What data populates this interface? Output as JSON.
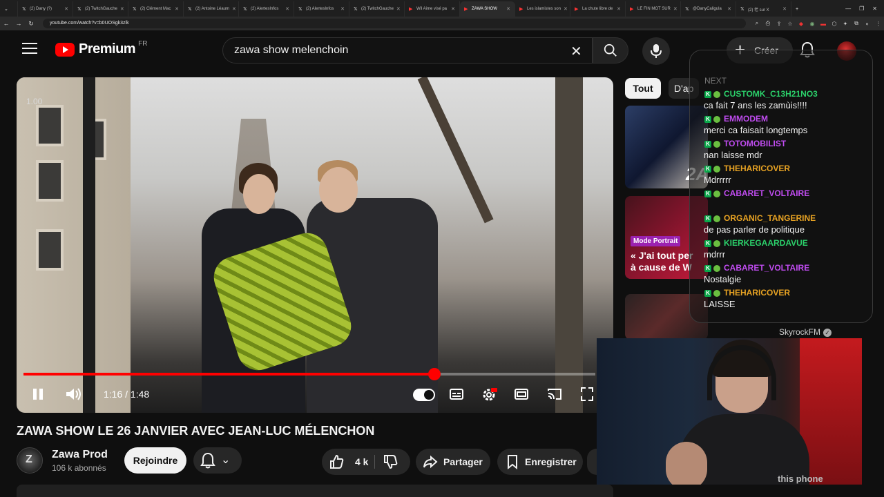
{
  "browser": {
    "tabs": [
      {
        "label": "(2) Dany (?)",
        "active": false
      },
      {
        "label": "(2) TwitchGauche",
        "active": false
      },
      {
        "label": "(2) Clément Mac",
        "active": false
      },
      {
        "label": "(2) Antoine Léaum",
        "active": false
      },
      {
        "label": "(2) AlertesInfos",
        "active": false
      },
      {
        "label": "(2) AlertesInfos",
        "active": false
      },
      {
        "label": "(2) TwitchGauche",
        "active": false
      },
      {
        "label": "Wil Aime visé pa",
        "active": false
      },
      {
        "label": "ZAWA SHOW",
        "active": true
      },
      {
        "label": "Les islamistes son",
        "active": false
      },
      {
        "label": "La chute libre de",
        "active": false
      },
      {
        "label": "LE FIN MOT SUR",
        "active": false
      },
      {
        "label": "@DanyCaligula",
        "active": false
      },
      {
        "label": "(2) 老 sur X",
        "active": false
      }
    ],
    "url": "youtube.com/watch?v=b0UOSgk3zlk"
  },
  "header": {
    "logo_text": "Premium",
    "region": "FR",
    "search_query": "zawa show melenchoin",
    "create_label": "Créer"
  },
  "player": {
    "speed_label": "1.00",
    "current_time": "1:16",
    "duration": "1:48",
    "time_display": "1:16 / 1:48",
    "progress_fraction": 0.718,
    "accent_color": "#ff0000"
  },
  "video": {
    "title": "ZAWA SHOW LE 26 JANVIER AVEC JEAN-LUC MÉLENCHON",
    "channel_name": "Zawa Prod",
    "subscribers": "106 k abonnés",
    "join_label": "Rejoindre",
    "likes": "4 k",
    "share_label": "Partager",
    "save_label": "Enregistrer"
  },
  "sidebar": {
    "chips": [
      "Tout",
      "D'ap"
    ],
    "thumb1_text": "2A",
    "thumb2_tag": "Mode Portrait",
    "thumb2_caption_line1": "« J'ai tout per",
    "thumb2_caption_line2": "à cause de W"
  },
  "chat": {
    "header": "NEXT",
    "messages": [
      {
        "user": "CUSTOMK_C13H21NO3",
        "color": "#2bd06a",
        "text": "ca fait 7 ans les zamùis!!!!"
      },
      {
        "user": "EMMODEM",
        "color": "#c04cf0",
        "text": "merci ca faisait longtemps"
      },
      {
        "user": "TOTOMOBILIST",
        "color": "#c04cf0",
        "text": "nan laisse mdr"
      },
      {
        "user": "THEHARICOVER",
        "color": "#e8a323",
        "text": "Mdrrrrr"
      },
      {
        "user": "CABARET_VOLTAIRE",
        "color": "#c04cf0",
        "text": ""
      },
      {
        "user": "ORGANIC_TANGERINE",
        "color": "#e8a323",
        "text": "de pas parler de politique"
      },
      {
        "user": "KIERKEGAARDAVUE",
        "color": "#2bd06a",
        "text": "mdrrr"
      },
      {
        "user": "CABARET_VOLTAIRE",
        "color": "#c04cf0",
        "text": "Nostalgie"
      },
      {
        "user": "THEHARICOVER",
        "color": "#e8a323",
        "text": "LAISSE"
      }
    ],
    "channel_label": "SkyrockFM"
  },
  "webcam": {
    "corner_text": "this phone"
  }
}
